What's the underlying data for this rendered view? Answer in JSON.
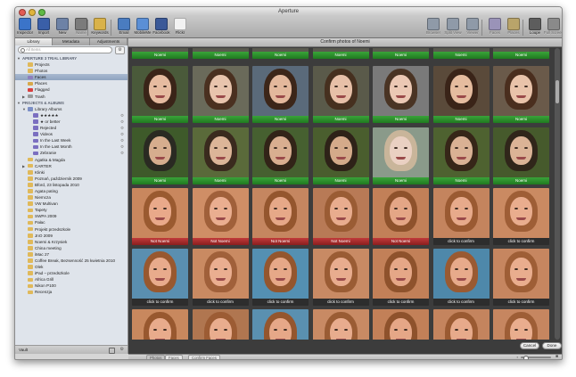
{
  "window": {
    "title": "Aperture"
  },
  "colors": {
    "green_label": "#2e8f2e",
    "red_label": "#a62a2a",
    "selection": "#9aabc6",
    "grid_bg": "#3c3c3c"
  },
  "toolbar": {
    "left": [
      {
        "label": "Inspector",
        "icon": "info-icon",
        "color": "#3b74c9"
      },
      {
        "label": "Import",
        "icon": "import-arrow-icon",
        "color": "#3a5fa8"
      },
      {
        "label": "New",
        "icon": "new-item-icon",
        "color": "#6d82a6"
      },
      {
        "label": "Name",
        "icon": "person-icon",
        "color": "#7b7b7b",
        "dim": true
      },
      {
        "label": "Keywords",
        "icon": "keyword-tag-icon",
        "color": "#d9b24a"
      },
      {
        "label": "Email",
        "icon": "email-icon",
        "color": "#4a7cc0"
      },
      {
        "label": "MobileMe",
        "icon": "cloud-icon",
        "color": "#5b8fd6"
      },
      {
        "label": "Facebook",
        "icon": "facebook-icon",
        "color": "#3b5998"
      },
      {
        "label": "Flickr",
        "icon": "flickr-icon",
        "color": "#f2f2f2"
      }
    ],
    "right": [
      {
        "label": "Browser",
        "icon": "browser-icon",
        "color": "#8f9aa8",
        "dim": true
      },
      {
        "label": "Split View",
        "icon": "split-view-icon",
        "color": "#8f9aa8",
        "dim": true
      },
      {
        "label": "Viewer",
        "icon": "viewer-icon",
        "color": "#8f9aa8",
        "dim": true
      },
      {
        "label": "Faces",
        "icon": "faces-icon",
        "color": "#9a93b8",
        "dim": true
      },
      {
        "label": "Places",
        "icon": "places-icon",
        "color": "#b9a46a",
        "dim": true
      },
      {
        "label": "Loupe",
        "icon": "loupe-icon",
        "color": "#5d5d5d"
      },
      {
        "label": "Full Screen",
        "icon": "full-screen-icon",
        "color": "#8a8a8a",
        "dim": true
      }
    ]
  },
  "sidebar": {
    "tabs": [
      {
        "label": "Library",
        "active": true
      },
      {
        "label": "Metadata",
        "active": false
      },
      {
        "label": "Adjustments",
        "active": false
      }
    ],
    "search_placeholder": "All Items",
    "footer_label": "Vault",
    "items": [
      {
        "label": "APERTURE 3 TRIAL LIBRARY",
        "kind": "header",
        "indent": 0,
        "disclosure": "▼"
      },
      {
        "label": "Projects",
        "icon": "projects-folder-icon",
        "icon_color": "#e0b95a",
        "indent": 1
      },
      {
        "label": "Photos",
        "icon": "photos-icon",
        "icon_color": "#e0b95a",
        "indent": 1
      },
      {
        "label": "Faces",
        "icon": "faces-icon",
        "icon_color": "#8d7fbd",
        "indent": 1,
        "selected": true
      },
      {
        "label": "Places",
        "icon": "places-icon",
        "icon_color": "#d8a84a",
        "indent": 1
      },
      {
        "label": "Flagged",
        "icon": "flag-icon",
        "icon_color": "#d84040",
        "indent": 1
      },
      {
        "label": "Trash",
        "icon": "trash-icon",
        "icon_color": "#9a9a9a",
        "indent": 1,
        "disclosure": "▶"
      },
      {
        "label": "PROJECTS & ALBUMS",
        "kind": "header",
        "indent": 0,
        "disclosure": "▼"
      },
      {
        "label": "Library Albums",
        "icon": "folder-icon",
        "icon_color": "#7b8fc6",
        "indent": 1,
        "disclosure": "▼"
      },
      {
        "label": "★★★★★",
        "icon": "smart-album-icon",
        "icon_color": "#7b6fc0",
        "indent": 2,
        "action": true
      },
      {
        "label": "★ or better",
        "icon": "smart-album-icon",
        "icon_color": "#7b6fc0",
        "indent": 2,
        "action": true
      },
      {
        "label": "Rejected",
        "icon": "smart-album-icon",
        "icon_color": "#7b6fc0",
        "indent": 2,
        "action": true
      },
      {
        "label": "Videos",
        "icon": "smart-album-icon",
        "icon_color": "#7b6fc0",
        "indent": 2,
        "action": true
      },
      {
        "label": "In the Last Week",
        "icon": "smart-album-icon",
        "icon_color": "#7b6fc0",
        "indent": 2,
        "action": true
      },
      {
        "label": "In the Last Month",
        "icon": "smart-album-icon",
        "icon_color": "#7b6fc0",
        "indent": 2,
        "action": true
      },
      {
        "label": "Zebranie",
        "icon": "smart-album-icon",
        "icon_color": "#7b6fc0",
        "indent": 2,
        "action": true
      },
      {
        "label": "Agatka & Magda",
        "icon": "project-icon",
        "icon_color": "#e0b95a",
        "indent": 1
      },
      {
        "label": "CARTER",
        "icon": "project-icon",
        "icon_color": "#e0b95a",
        "indent": 1,
        "disclosure": "▶"
      },
      {
        "label": "Klinki",
        "icon": "project-icon",
        "icon_color": "#e0b95a",
        "indent": 1
      },
      {
        "label": "Poznań, październik 2009",
        "icon": "project-icon",
        "icon_color": "#e0b95a",
        "indent": 1
      },
      {
        "label": "Bford, 23 listopada 2010",
        "icon": "project-icon",
        "icon_color": "#e0b95a",
        "indent": 1
      },
      {
        "label": "Agata pating",
        "icon": "project-icon",
        "icon_color": "#e0b95a",
        "indent": 1
      },
      {
        "label": "Niemcza",
        "icon": "project-icon",
        "icon_color": "#e0b95a",
        "indent": 1
      },
      {
        "label": "VW Multivan",
        "icon": "project-icon",
        "icon_color": "#e0b95a",
        "indent": 1
      },
      {
        "label": "Tapety",
        "icon": "project-icon",
        "icon_color": "#e0b95a",
        "indent": 1
      },
      {
        "label": "SWPA 2009",
        "icon": "project-icon",
        "icon_color": "#e0b95a",
        "indent": 1
      },
      {
        "label": "Pałac",
        "icon": "project-icon",
        "icon_color": "#e0b95a",
        "indent": 1
      },
      {
        "label": "Projekt przedszkole",
        "icon": "project-icon",
        "icon_color": "#e0b95a",
        "indent": 1
      },
      {
        "label": "JnO 2009",
        "icon": "project-icon",
        "icon_color": "#e0b95a",
        "indent": 1
      },
      {
        "label": "Noemi & Krzysiek",
        "icon": "project-icon",
        "icon_color": "#e0b95a",
        "indent": 1
      },
      {
        "label": "China meeting",
        "icon": "project-icon",
        "icon_color": "#e0b95a",
        "indent": 1
      },
      {
        "label": "iMac 27",
        "icon": "project-icon",
        "icon_color": "#e0b95a",
        "indent": 1
      },
      {
        "label": "Coffee Break, Bezsenność 25 kwietnia 2010",
        "icon": "project-icon",
        "icon_color": "#e0b95a",
        "indent": 1
      },
      {
        "label": "Olek",
        "icon": "project-icon",
        "icon_color": "#e0b95a",
        "indent": 1
      },
      {
        "label": "iPad – przedszkole",
        "icon": "project-icon",
        "icon_color": "#e0b95a",
        "indent": 1
      },
      {
        "label": "Africa Grill",
        "icon": "project-icon",
        "icon_color": "#e0b95a",
        "indent": 1
      },
      {
        "label": "Nikon P100",
        "icon": "project-icon",
        "icon_color": "#e0b95a",
        "indent": 1
      },
      {
        "label": "Recenzja",
        "icon": "project-icon",
        "icon_color": "#e0b95a",
        "indent": 1
      }
    ]
  },
  "main": {
    "header_title": "Confirm photos of Noemi",
    "cancel_label": "Cancel",
    "done_label": "Done",
    "grid": [
      {
        "label": "Noemi",
        "status": "confirmed"
      },
      {
        "label": "Noemi",
        "status": "confirmed"
      },
      {
        "label": "Noemi",
        "status": "confirmed"
      },
      {
        "label": "Noemi",
        "status": "confirmed"
      },
      {
        "label": "Noemi",
        "status": "confirmed"
      },
      {
        "label": "Noemi",
        "status": "confirmed"
      },
      {
        "label": "Noemi",
        "status": "confirmed"
      },
      {
        "label": "Noemi",
        "status": "confirmed",
        "skin": "#e6bba0",
        "hair": "#3a2418",
        "bg": "#4a5a3a"
      },
      {
        "label": "Noemi",
        "status": "confirmed",
        "skin": "#e8c4ad",
        "hair": "#4a3020",
        "bg": "#6a6a5a"
      },
      {
        "label": "Noemi",
        "status": "confirmed",
        "skin": "#e3b89c",
        "hair": "#3c2619",
        "bg": "#5a6a7a"
      },
      {
        "label": "Noemi",
        "status": "confirmed",
        "skin": "#e7c0a8",
        "hair": "#46301f",
        "bg": "#5a5a4a"
      },
      {
        "label": "Noemi",
        "status": "confirmed",
        "skin": "#ebc8b4",
        "hair": "#4a3424",
        "bg": "#7a7a7a"
      },
      {
        "label": "Noemi",
        "status": "confirmed",
        "skin": "#e5bc9f",
        "hair": "#3a2418",
        "bg": "#5a4a3a"
      },
      {
        "label": "Noemi",
        "status": "confirmed",
        "skin": "#e9c3aa",
        "hair": "#4a2e1e",
        "bg": "#6a5a4a"
      },
      {
        "label": "Noemi",
        "status": "confirmed",
        "skin": "#d6ad8e",
        "hair": "#2a2a22",
        "bg": "#3e5a2a"
      },
      {
        "label": "Noemi",
        "status": "confirmed",
        "skin": "#dcb598",
        "hair": "#3a2a1e",
        "bg": "#5a6a3a"
      },
      {
        "label": "Noemi",
        "status": "confirmed",
        "skin": "#d8ae90",
        "hair": "#322418",
        "bg": "#466030"
      },
      {
        "label": "Noemi",
        "status": "confirmed",
        "skin": "#d4aa8a",
        "hair": "#2e2218",
        "bg": "#4a5e2e"
      },
      {
        "label": "Noemi",
        "status": "confirmed",
        "skin": "#ead0c2",
        "hair": "#c9b59a",
        "bg": "#8a9a8a"
      },
      {
        "label": "Noemi",
        "status": "confirmed",
        "skin": "#d9b194",
        "hair": "#362618",
        "bg": "#4e6230"
      },
      {
        "label": "Noemi",
        "status": "confirmed",
        "skin": "#dbb396",
        "hair": "#30261a",
        "bg": "#465a2c"
      },
      {
        "label": "Not Noemi",
        "status": "rejected",
        "skin": "#e9a98a",
        "hair": "#9a5a30",
        "bg": "#c9875e"
      },
      {
        "label": "Not Noemi",
        "status": "rejected",
        "skin": "#eaae90",
        "hair": "#a0603a",
        "bg": "#cf8e66"
      },
      {
        "label": "Not Noemi",
        "status": "rejected",
        "skin": "#e6a888",
        "hair": "#94562e",
        "bg": "#c58660"
      },
      {
        "label": "Not Noemi",
        "status": "rejected",
        "skin": "#e8ac8e",
        "hair": "#9a5c34",
        "bg": "#b87a56"
      },
      {
        "label": "Not Noemi",
        "status": "rejected",
        "skin": "#e4a686",
        "hair": "#8e522c",
        "bg": "#c28058"
      },
      {
        "label": "click to confirm",
        "status": "unconfirmed",
        "skin": "#e7aa8b",
        "hair": "#9a5a32",
        "bg": "#c4845e"
      },
      {
        "label": "click to confirm",
        "status": "unconfirmed",
        "skin": "#e9ad8e",
        "hair": "#9e5e36",
        "bg": "#ca8a62"
      },
      {
        "label": "click to confirm",
        "status": "unconfirmed",
        "skin": "#e8ab8c",
        "hair": "#98582f",
        "bg": "#5a8fb0"
      },
      {
        "label": "click to confirm",
        "status": "unconfirmed",
        "skin": "#eaae90",
        "hair": "#a0603a",
        "bg": "#c98a62"
      },
      {
        "label": "click to confirm",
        "status": "unconfirmed",
        "skin": "#e6a888",
        "hair": "#94562e",
        "bg": "#5490b2"
      },
      {
        "label": "click to confirm",
        "status": "unconfirmed",
        "skin": "#e8ac8e",
        "hair": "#9a5c34",
        "bg": "#c88a64"
      },
      {
        "label": "click to confirm",
        "status": "unconfirmed",
        "skin": "#e5a787",
        "hair": "#8e522c",
        "bg": "#c28058"
      },
      {
        "label": "click to confirm",
        "status": "unconfirmed",
        "skin": "#e7aa8b",
        "hair": "#9a5a32",
        "bg": "#4e88aa"
      },
      {
        "label": "click to confirm",
        "status": "unconfirmed",
        "skin": "#e9ad8e",
        "hair": "#9e5e36",
        "bg": "#c68660"
      },
      {
        "label": "",
        "status": "partial",
        "skin": "#e8ab8c",
        "hair": "#98582f",
        "bg": "#c8885e"
      },
      {
        "label": "",
        "status": "partial",
        "skin": "#e9ad8e",
        "hair": "#9c5c34",
        "bg": "#b07650"
      },
      {
        "label": "",
        "status": "partial",
        "skin": "#e6a888",
        "hair": "#94562e",
        "bg": "#5a90b0"
      },
      {
        "label": "",
        "status": "partial",
        "skin": "#e8ac8e",
        "hair": "#9a5c34",
        "bg": "#c88a64"
      },
      {
        "label": "",
        "status": "partial",
        "skin": "#e5a787",
        "hair": "#8e522c",
        "bg": "#c28058"
      },
      {
        "label": "",
        "status": "partial",
        "skin": "#e7aa8b",
        "hair": "#9a5a32",
        "bg": "#c4845e"
      },
      {
        "label": "",
        "status": "partial",
        "skin": "#e9ad8e",
        "hair": "#9e5e36",
        "bg": "#c68660"
      }
    ]
  },
  "footer": {
    "tabs": [
      {
        "label": "Photos",
        "active": true
      },
      {
        "label": "Faces",
        "active": false
      },
      {
        "label": "Confirm Faces",
        "active": false
      }
    ]
  }
}
